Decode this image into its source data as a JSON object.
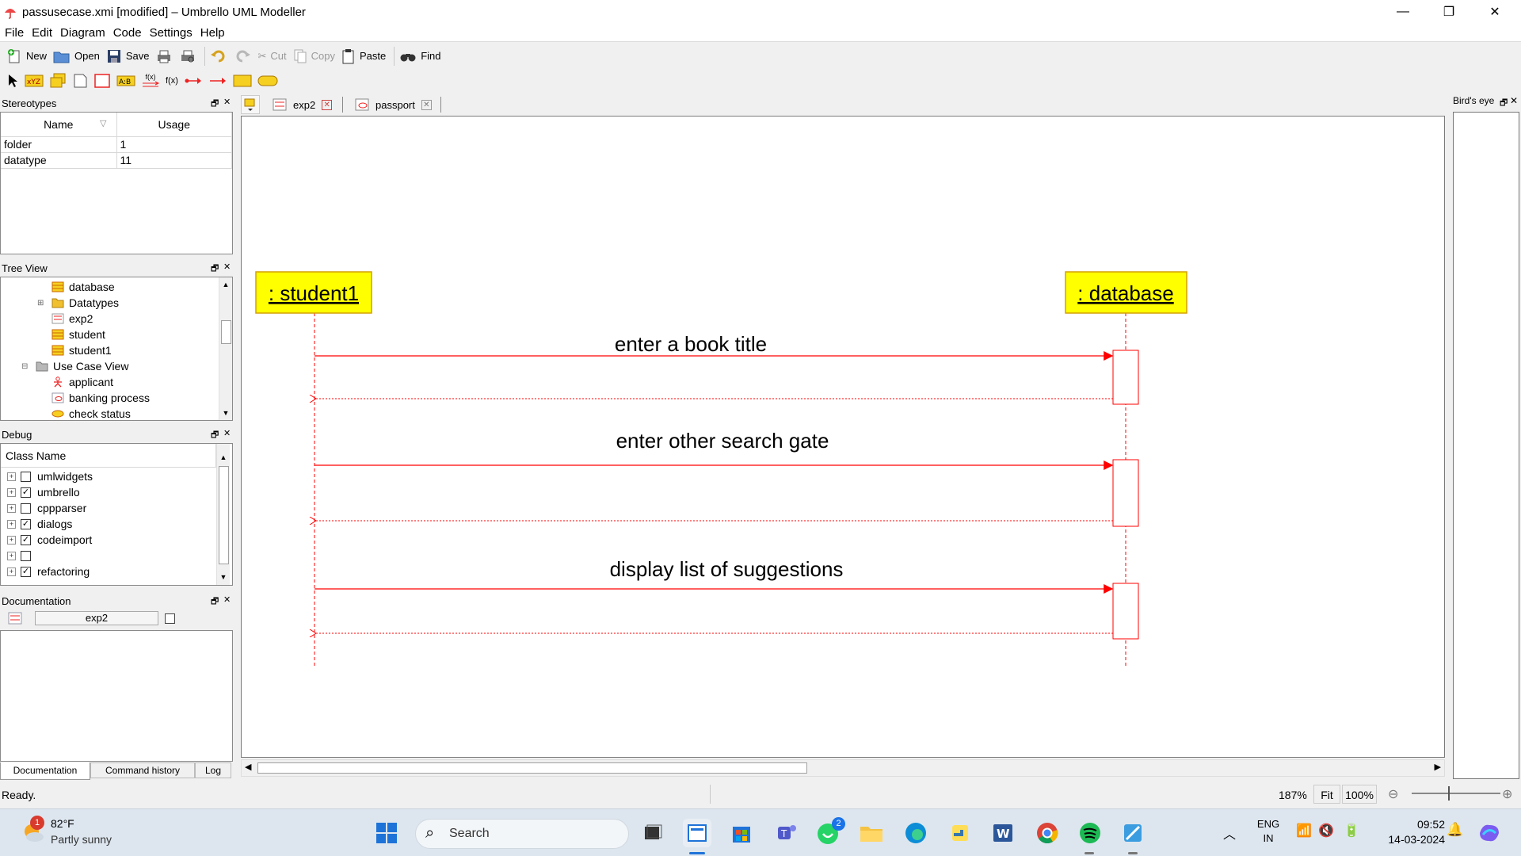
{
  "window": {
    "title": "passusecase.xmi [modified] – Umbrello UML Modeller"
  },
  "menu": [
    "File",
    "Edit",
    "Diagram",
    "Code",
    "Settings",
    "Help"
  ],
  "toolbar": {
    "new": "New",
    "open": "Open",
    "save": "Save",
    "cut": "Cut",
    "copy": "Copy",
    "paste": "Paste",
    "find": "Find"
  },
  "drawbar": {
    "fx1": "f(x)",
    "fx2": "f(x)"
  },
  "stereotypes": {
    "title": "Stereotypes",
    "columns": [
      "Name",
      "Usage"
    ],
    "rows": [
      {
        "name": "folder",
        "usage": "1"
      },
      {
        "name": "datatype",
        "usage": "11"
      }
    ]
  },
  "tree": {
    "title": "Tree View",
    "items": [
      {
        "label": "database",
        "icon": "class-icon"
      },
      {
        "label": "Datatypes",
        "icon": "folder-icon"
      },
      {
        "label": "exp2",
        "icon": "diagram-icon"
      },
      {
        "label": "student",
        "icon": "class-icon"
      },
      {
        "label": "student1",
        "icon": "class-icon"
      },
      {
        "label": "Use Case View",
        "icon": "folder-icon"
      },
      {
        "label": "applicant",
        "icon": "actor-icon"
      },
      {
        "label": "banking process",
        "icon": "diagram-icon"
      },
      {
        "label": "check status",
        "icon": "usecase-icon"
      }
    ]
  },
  "debug": {
    "title": "Debug",
    "header": "Class Name",
    "rows": [
      {
        "label": "umlwidgets",
        "checked": false
      },
      {
        "label": "umbrello",
        "checked": true
      },
      {
        "label": "cppparser",
        "checked": false
      },
      {
        "label": "dialogs",
        "checked": true
      },
      {
        "label": "codeimport",
        "checked": true
      },
      {
        "label": "",
        "checked": false
      },
      {
        "label": "refactoring",
        "checked": true
      }
    ]
  },
  "documentation": {
    "title": "Documentation",
    "field_value": "exp2"
  },
  "bottom_tabs": [
    "Documentation",
    "Command history",
    "Log"
  ],
  "tabs": [
    {
      "label": "exp2"
    },
    {
      "label": "passport"
    }
  ],
  "birdseye": {
    "title": "Bird's eye"
  },
  "diagram": {
    "objects": [
      {
        "label": " : student1"
      },
      {
        "label": " : database"
      }
    ],
    "messages": [
      {
        "label": "enter a book title"
      },
      {
        "label": "enter other search gate"
      },
      {
        "label": "display list of suggestions"
      }
    ]
  },
  "status": {
    "text": "Ready.",
    "zoom": "187%",
    "fit": "Fit",
    "reset": "100%"
  },
  "taskbar": {
    "weather_temp": "82°F",
    "weather_desc": "Partly sunny",
    "weather_badge": "1",
    "search_placeholder": "Search",
    "whatsapp_badge": "2",
    "lang1": "ENG",
    "lang2": "IN",
    "time": "09:52",
    "date": "14-03-2024"
  },
  "colors": {
    "lifeline": "#ff0000",
    "object_fill": "#ffff00",
    "accent": "#1a73e8"
  }
}
